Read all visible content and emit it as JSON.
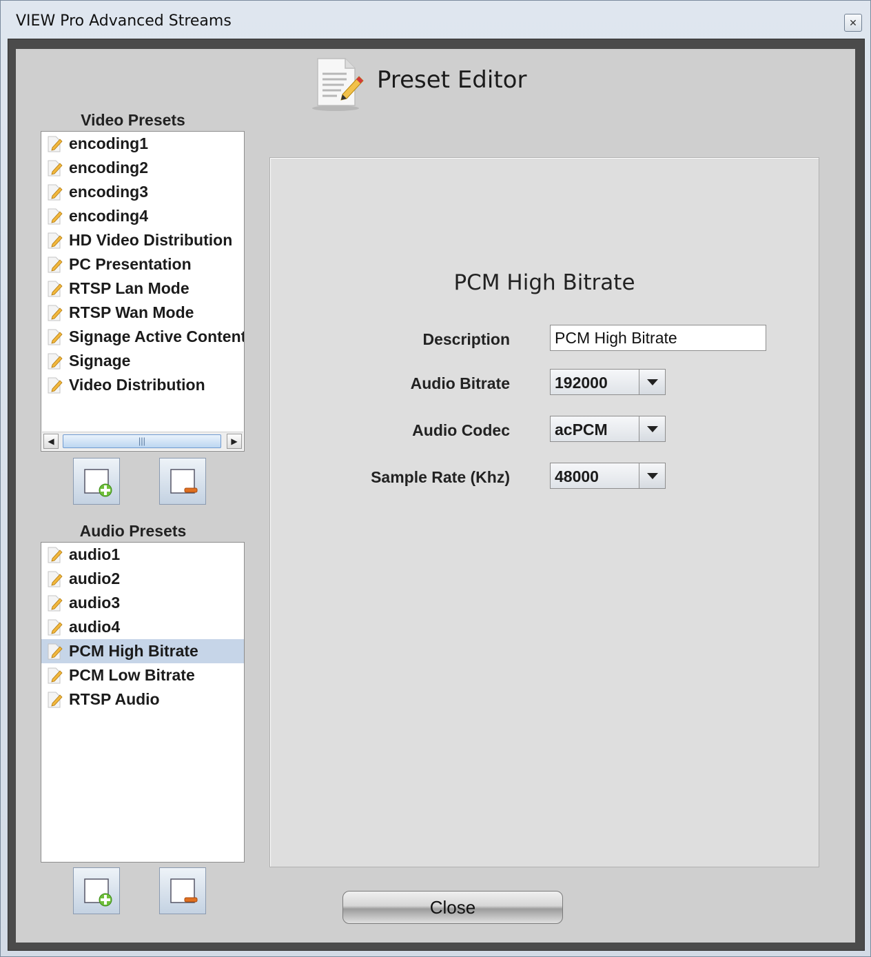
{
  "window": {
    "title": "VIEW Pro Advanced Streams"
  },
  "header": {
    "title": "Preset Editor",
    "icon": "document-edit-icon"
  },
  "video_presets": {
    "title": "Video Presets",
    "items": [
      "encoding1",
      "encoding2",
      "encoding3",
      "encoding4",
      "HD Video Distribution",
      "PC Presentation",
      "RTSP Lan Mode",
      "RTSP Wan Mode",
      "Signage Active Content",
      "Signage",
      "Video Distribution"
    ]
  },
  "audio_presets": {
    "title": "Audio Presets",
    "items": [
      "audio1",
      "audio2",
      "audio3",
      "audio4",
      "PCM High Bitrate",
      "PCM Low Bitrate",
      "RTSP Audio"
    ],
    "selected": "PCM High Bitrate"
  },
  "editor": {
    "preset_name": "PCM High Bitrate",
    "description_label": "Description",
    "description_value": "PCM High Bitrate",
    "audio_bitrate_label": "Audio Bitrate",
    "audio_bitrate_value": "192000",
    "audio_codec_label": "Audio Codec",
    "audio_codec_value": "acPCM",
    "sample_rate_label": "Sample Rate (Khz)",
    "sample_rate_value": "48000"
  },
  "buttons": {
    "close": "Close"
  },
  "colors": {
    "selection": "#c6d5e8",
    "frame": "#4b4b4b",
    "panel": "#cfcfcf"
  }
}
